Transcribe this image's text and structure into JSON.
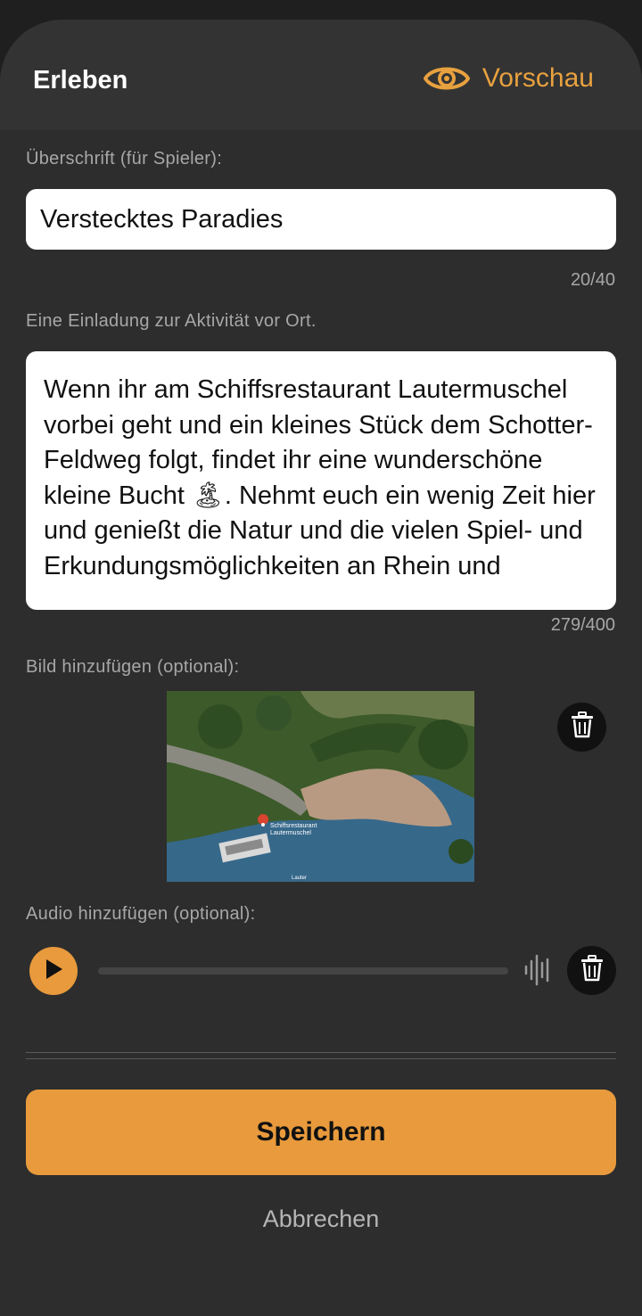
{
  "header": {
    "title": "Erleben",
    "preview_label": "Vorschau",
    "preview_icon": "eye-icon"
  },
  "heading_field": {
    "label": "Überschrift (für Spieler):",
    "value": "Verstecktes Paradies",
    "counter": "20/40"
  },
  "description_field": {
    "label": "Eine Einladung zur Aktivität vor Ort.",
    "value": "Wenn ihr am Schiffsrestaurant Lautermuschel vorbei geht und ein kleines Stück dem Schotter-Feldweg folgt, findet ihr eine wunderschöne kleine Bucht 🏝. Nehmt euch ein wenig Zeit hier und genießt die Natur und die vielen Spiel- und Erkundungsmöglichkeiten an Rhein und",
    "counter": "279/400"
  },
  "image_section": {
    "label": "Bild hinzufügen (optional):",
    "map_pin_label_line1": "Schiffsrestaurant",
    "map_pin_label_line2": "Lautermuschel",
    "map_water_label": "Lauter",
    "delete_icon": "trash-icon"
  },
  "audio_section": {
    "label": "Audio hinzufügen (optional):",
    "play_icon": "play-icon",
    "waveform_icon": "waveform-icon",
    "delete_icon": "trash-icon"
  },
  "actions": {
    "save_label": "Speichern",
    "cancel_label": "Abbrechen"
  },
  "colors": {
    "accent": "#e89a3c",
    "background": "#2d2d2d",
    "header": "#333333"
  }
}
